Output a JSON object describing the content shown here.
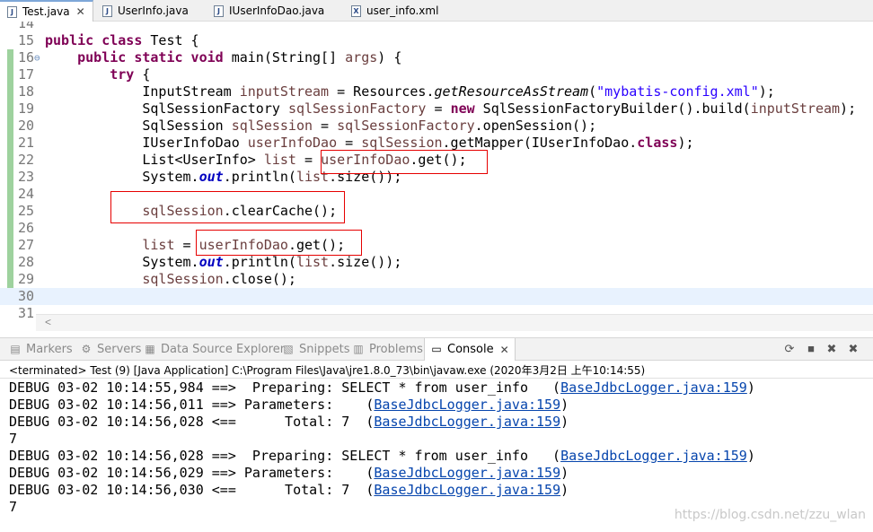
{
  "editor_tabs": [
    {
      "label": "Test.java",
      "icon": "java-file-icon",
      "glyph": "J",
      "active": true
    },
    {
      "label": "UserInfo.java",
      "icon": "java-file-icon",
      "glyph": "J"
    },
    {
      "label": "IUserInfoDao.java",
      "icon": "java-file-icon",
      "glyph": "J"
    },
    {
      "label": "user_info.xml",
      "icon": "xml-file-icon",
      "glyph": "X"
    }
  ],
  "tab_close": "✕",
  "code": {
    "lines": [
      {
        "n": "14",
        "segs": []
      },
      {
        "n": "15",
        "segs": [
          {
            "t": "public class ",
            "c": "kw"
          },
          {
            "t": "Test {"
          }
        ]
      },
      {
        "n": "16",
        "fold": "⊖",
        "segs": [
          {
            "t": "    "
          },
          {
            "t": "public static void ",
            "c": "kw"
          },
          {
            "t": "main(String[] "
          },
          {
            "t": "args",
            "c": "var"
          },
          {
            "t": ") {"
          }
        ]
      },
      {
        "n": "17",
        "segs": [
          {
            "t": "        "
          },
          {
            "t": "try",
            "c": "kw"
          },
          {
            "t": " {"
          }
        ]
      },
      {
        "n": "18",
        "segs": [
          {
            "t": "            InputStream "
          },
          {
            "t": "inputStream",
            "c": "var"
          },
          {
            "t": " = Resources."
          },
          {
            "t": "getResourceAsStream",
            "c": "it"
          },
          {
            "t": "("
          },
          {
            "t": "\"mybatis-config.xml\"",
            "c": "str"
          },
          {
            "t": ");"
          }
        ]
      },
      {
        "n": "19",
        "segs": [
          {
            "t": "            SqlSessionFactory "
          },
          {
            "t": "sqlSessionFactory",
            "c": "var"
          },
          {
            "t": " = "
          },
          {
            "t": "new",
            "c": "kw"
          },
          {
            "t": " SqlSessionFactoryBuilder().build("
          },
          {
            "t": "inputStream",
            "c": "var"
          },
          {
            "t": ");"
          }
        ]
      },
      {
        "n": "20",
        "segs": [
          {
            "t": "            SqlSession "
          },
          {
            "t": "sqlSession",
            "c": "var"
          },
          {
            "t": " = "
          },
          {
            "t": "sqlSessionFactory",
            "c": "var"
          },
          {
            "t": ".openSession();"
          }
        ]
      },
      {
        "n": "21",
        "segs": [
          {
            "t": "            IUserInfoDao "
          },
          {
            "t": "userInfoDao",
            "c": "var"
          },
          {
            "t": " = "
          },
          {
            "t": "sqlSession",
            "c": "var"
          },
          {
            "t": ".getMapper(IUserInfoDao."
          },
          {
            "t": "class",
            "c": "kw"
          },
          {
            "t": ");"
          }
        ]
      },
      {
        "n": "22",
        "segs": [
          {
            "t": "            List<UserInfo> "
          },
          {
            "t": "list",
            "c": "var"
          },
          {
            "t": " = "
          },
          {
            "t": "userInfoDao",
            "c": "var"
          },
          {
            "t": ".get();"
          }
        ]
      },
      {
        "n": "23",
        "segs": [
          {
            "t": "            System."
          },
          {
            "t": "out",
            "c": "st"
          },
          {
            "t": ".println("
          },
          {
            "t": "list",
            "c": "var"
          },
          {
            "t": ".size());"
          }
        ]
      },
      {
        "n": "24",
        "segs": []
      },
      {
        "n": "25",
        "segs": [
          {
            "t": "            "
          },
          {
            "t": "sqlSession",
            "c": "var"
          },
          {
            "t": ".clearCache();"
          }
        ]
      },
      {
        "n": "26",
        "segs": []
      },
      {
        "n": "27",
        "segs": [
          {
            "t": "            "
          },
          {
            "t": "list",
            "c": "var"
          },
          {
            "t": " = "
          },
          {
            "t": "userInfoDao",
            "c": "var"
          },
          {
            "t": ".get();"
          }
        ]
      },
      {
        "n": "28",
        "segs": [
          {
            "t": "            System."
          },
          {
            "t": "out",
            "c": "st"
          },
          {
            "t": ".println("
          },
          {
            "t": "list",
            "c": "var"
          },
          {
            "t": ".size());"
          }
        ]
      },
      {
        "n": "29",
        "segs": [
          {
            "t": "            "
          },
          {
            "t": "sqlSession",
            "c": "var"
          },
          {
            "t": ".close();"
          }
        ]
      },
      {
        "n": "30",
        "segs": [],
        "current": true
      },
      {
        "n": "31",
        "segs": []
      }
    ]
  },
  "view_tabs": [
    {
      "label": "Markers",
      "icon": "markers-icon",
      "glyph": "▤"
    },
    {
      "label": "Servers",
      "icon": "servers-icon",
      "glyph": "⚙"
    },
    {
      "label": "Data Source Explorer",
      "icon": "data-source-icon",
      "glyph": "▦"
    },
    {
      "label": "Snippets",
      "icon": "snippets-icon",
      "glyph": "▧"
    },
    {
      "label": "Problems",
      "icon": "problems-icon",
      "glyph": "▥"
    },
    {
      "label": "Console",
      "icon": "console-icon",
      "glyph": "▭",
      "active": true,
      "close": "✕"
    }
  ],
  "toolbar_icons": [
    {
      "name": "refresh-icon",
      "glyph": "⟳"
    },
    {
      "name": "terminate-icon",
      "glyph": "■"
    },
    {
      "name": "remove-launch-icon",
      "glyph": "✖"
    },
    {
      "name": "remove-all-icon",
      "glyph": "✖"
    }
  ],
  "console": {
    "header": "<terminated> Test (9) [Java Application] C:\\Program Files\\Java\\jre1.8.0_73\\bin\\javaw.exe (2020年3月2日 上午10:14:55)",
    "lines": [
      {
        "text": "DEBUG 03-02 10:14:55,984 ==>  Preparing: SELECT * from user_info   (",
        "link": "BaseJdbcLogger.java:159",
        "tail": ")"
      },
      {
        "text": "DEBUG 03-02 10:14:56,011 ==> Parameters:    (",
        "link": "BaseJdbcLogger.java:159",
        "tail": ")"
      },
      {
        "text": "DEBUG 03-02 10:14:56,028 <==      Total: 7  (",
        "link": "BaseJdbcLogger.java:159",
        "tail": ")"
      },
      {
        "text": "7"
      },
      {
        "text": "DEBUG 03-02 10:14:56,028 ==>  Preparing: SELECT * from user_info   (",
        "link": "BaseJdbcLogger.java:159",
        "tail": ")"
      },
      {
        "text": "DEBUG 03-02 10:14:56,029 ==> Parameters:    (",
        "link": "BaseJdbcLogger.java:159",
        "tail": ")"
      },
      {
        "text": "DEBUG 03-02 10:14:56,030 <==      Total: 7  (",
        "link": "BaseJdbcLogger.java:159",
        "tail": ")"
      },
      {
        "text": "7"
      }
    ]
  },
  "watermark": "https://blog.csdn.net/zzu_wlan",
  "colors": {
    "keyword": "#7f0055",
    "local_var": "#6a3e3e",
    "string": "#2a00ff",
    "static_field": "#0000c0",
    "highlight_box": "#e60000",
    "link": "#0645ad"
  }
}
